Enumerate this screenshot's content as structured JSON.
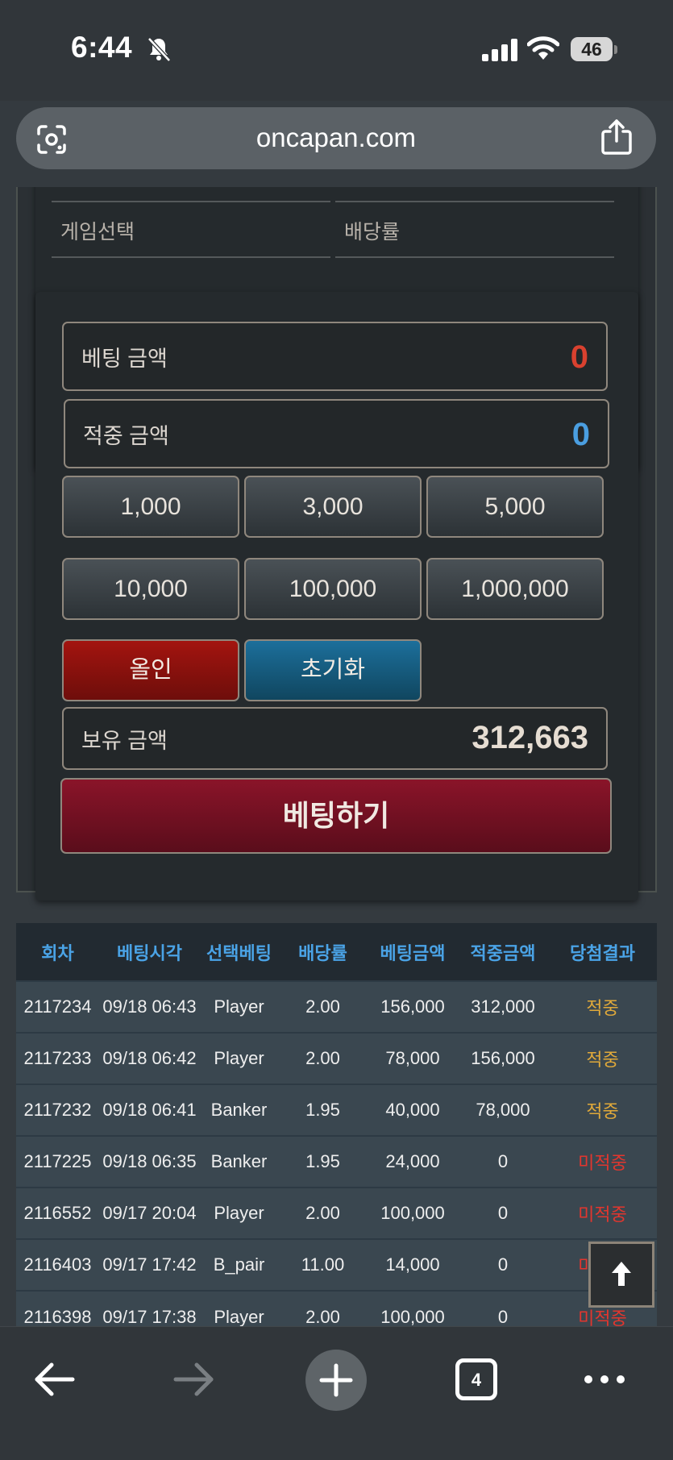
{
  "status_bar": {
    "time": "6:44",
    "battery": "46"
  },
  "browser": {
    "url": "oncapan.com",
    "tab_count": "4"
  },
  "game_select": {
    "game_label": "게임선택",
    "odds_label": "배당률"
  },
  "bet_form": {
    "bet_amount_label": "베팅 금액",
    "bet_amount_value": "0",
    "win_amount_label": "적중 금액",
    "win_amount_value": "0",
    "chips": [
      "1,000",
      "3,000",
      "5,000",
      "10,000",
      "100,000",
      "1,000,000"
    ],
    "allin_label": "올인",
    "reset_label": "초기화",
    "balance_label": "보유 금액",
    "balance_value": "312,663",
    "submit_label": "베팅하기"
  },
  "history": {
    "columns": [
      "회차",
      "베팅시각",
      "선택베팅",
      "배당률",
      "베팅금액",
      "적중금액",
      "당첨결과"
    ],
    "rows": [
      [
        "2117234",
        "09/18 06:43",
        "Player",
        "2.00",
        "156,000",
        "312,000",
        "적중"
      ],
      [
        "2117233",
        "09/18 06:42",
        "Player",
        "2.00",
        "78,000",
        "156,000",
        "적중"
      ],
      [
        "2117232",
        "09/18 06:41",
        "Banker",
        "1.95",
        "40,000",
        "78,000",
        "적중"
      ],
      [
        "2117225",
        "09/18 06:35",
        "Banker",
        "1.95",
        "24,000",
        "0",
        "미적중"
      ],
      [
        "2116552",
        "09/17 20:04",
        "Player",
        "2.00",
        "100,000",
        "0",
        "미적중"
      ],
      [
        "2116403",
        "09/17 17:42",
        "B_pair",
        "11.00",
        "14,000",
        "0",
        "미적중"
      ],
      [
        "2116398",
        "09/17 17:38",
        "Player",
        "2.00",
        "100,000",
        "0",
        "미적중"
      ]
    ]
  },
  "colors": {
    "bet_amount": "#d9412f",
    "win_amount": "#4a9ee0",
    "hit": "#e0a93a",
    "miss": "#e2362e"
  }
}
